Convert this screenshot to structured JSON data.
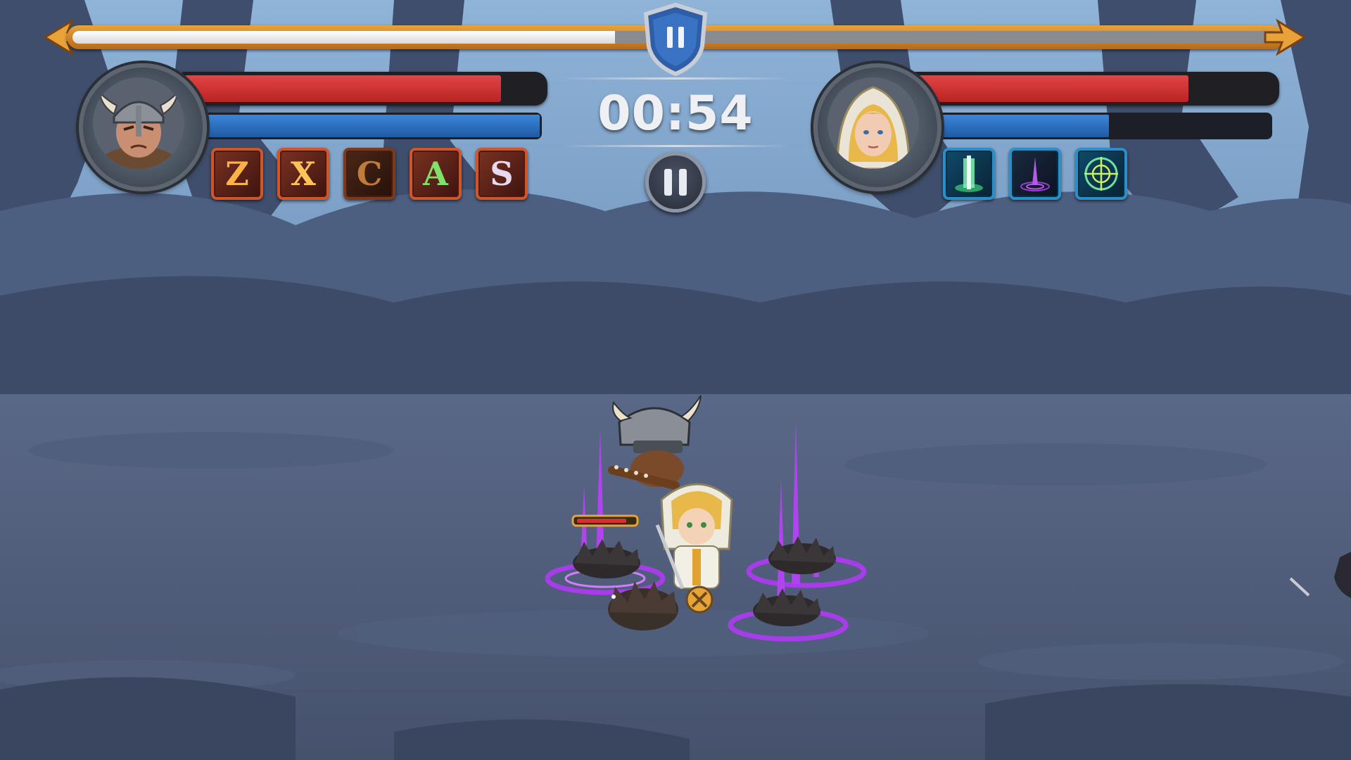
{
  "hud": {
    "timer": "00:54",
    "match_progress": 0.45
  },
  "player": {
    "hero": "viking",
    "hp": 0.88,
    "mana": 1.0,
    "skills": [
      {
        "key": "Z",
        "color": "#ffb347"
      },
      {
        "key": "X",
        "color": "#ffc35a"
      },
      {
        "key": "C",
        "color": "#c07a3a"
      },
      {
        "key": "A",
        "color": "#7fe06a"
      },
      {
        "key": "S",
        "color": "#e7d9f0"
      }
    ]
  },
  "enemy": {
    "hero": "blonde-cleric",
    "hp": 0.76,
    "mana": 0.55,
    "skills": [
      {
        "icon": "light-pillar-icon"
      },
      {
        "icon": "shadow-spike-icon"
      },
      {
        "icon": "rune-circle-icon"
      }
    ]
  },
  "colors": {
    "hp": "#d43232",
    "mana": "#2a6fc0",
    "frame_gold": "#d88a2a"
  }
}
